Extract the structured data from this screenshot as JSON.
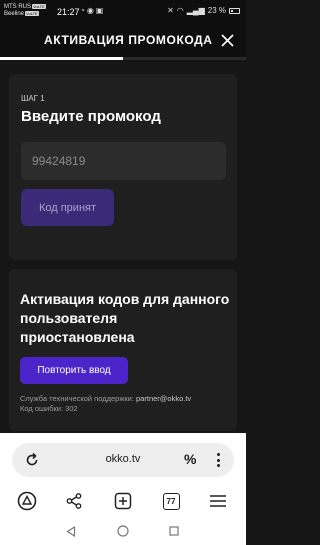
{
  "status_bar": {
    "carrier1": "MTS RUS",
    "carrier1_tag": "VoLTE",
    "carrier2": "Beeline",
    "carrier2_tag": "VoLTE",
    "time": "21:27",
    "battery": "23 %"
  },
  "header": {
    "title": "АКТИВАЦИЯ ПРОМОКОДА",
    "close_icon": "close-icon",
    "progress": 0.5
  },
  "step_card": {
    "step_label": "ШАГ 1",
    "title": "Введите промокод",
    "promo_value": "99424819",
    "accepted_button": "Код принят"
  },
  "error_card": {
    "title": "Активация кодов для данного пользователя приостановлена",
    "retry_button": "Повторить ввод",
    "support_prefix": "Служба технической поддержки:",
    "support_email": "partner@okko.tv",
    "error_code": "Код ошибки: 302"
  },
  "browser": {
    "url": "okko.tv",
    "reload_icon": "reload-icon",
    "percent_label": "%",
    "more_icon": "more-vertical-icon",
    "tabs_count": "77",
    "tools": [
      "home-icon",
      "share-icon",
      "new-tab-icon",
      "tabs-icon",
      "menu-icon"
    ]
  },
  "navigation": [
    "back-icon",
    "home-circle-icon",
    "recents-icon"
  ],
  "colors": {
    "background": "#161616",
    "card": "#1f1f1f",
    "accent": "#4b25c9",
    "accent_disabled": "#3a2a78"
  }
}
